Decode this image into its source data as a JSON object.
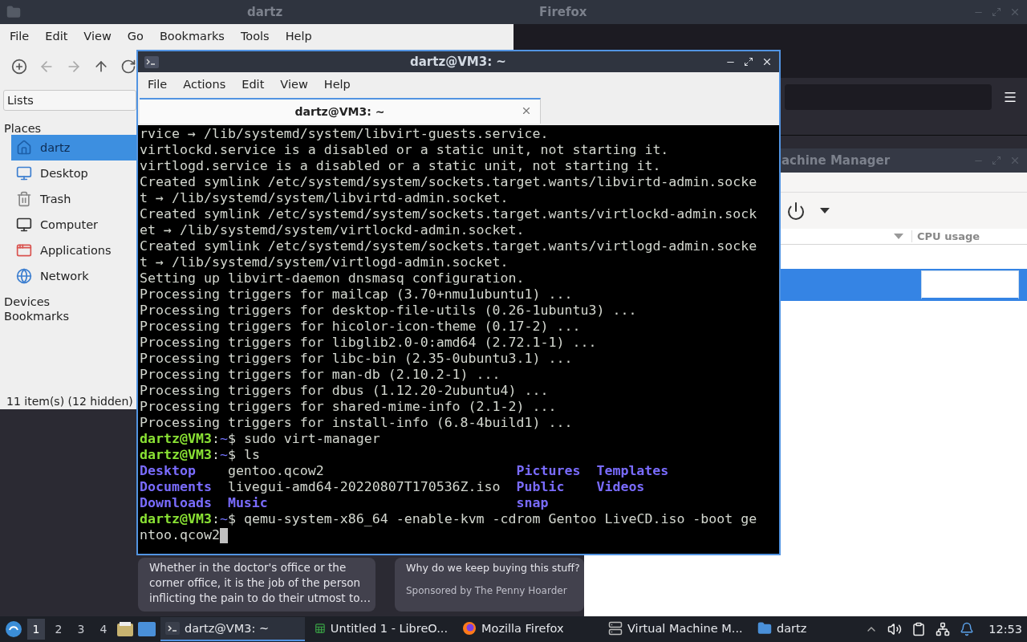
{
  "firefox": {
    "title": "Firefox",
    "cards": [
      {
        "lines": [
          "Whether in the doctor's office or the",
          "corner office, it is the job of the person",
          "inflicting the pain to do their utmost to…"
        ]
      },
      {
        "title": "Why do we keep buying this stuff?",
        "sponsor": "Sponsored by The Penny Hoarder"
      }
    ]
  },
  "file_manager": {
    "title": "dartz",
    "menu": [
      "File",
      "Edit",
      "View",
      "Go",
      "Bookmarks",
      "Tools",
      "Help"
    ],
    "toolbar": [
      {
        "kind": "new-window",
        "disabled": false
      },
      {
        "kind": "back",
        "disabled": true
      },
      {
        "kind": "forward",
        "disabled": true
      },
      {
        "kind": "up",
        "disabled": false
      },
      {
        "kind": "reload",
        "disabled": false
      }
    ],
    "side_view": "Lists",
    "places_label": "Places",
    "places": [
      {
        "label": "dartz",
        "kind": "home",
        "selected": true
      },
      {
        "label": "Desktop",
        "kind": "desktop",
        "selected": false
      },
      {
        "label": "Trash",
        "kind": "trash",
        "selected": false
      },
      {
        "label": "Computer",
        "kind": "computer",
        "selected": false
      },
      {
        "label": "Applications",
        "kind": "applications",
        "selected": false
      },
      {
        "label": "Network",
        "kind": "network",
        "selected": false
      }
    ],
    "other_sections": [
      "Devices",
      "Bookmarks"
    ],
    "status": "11 item(s) (12 hidden)"
  },
  "virt_manager": {
    "title": "achine Manager",
    "column": "CPU usage",
    "rows": [
      {
        "selected": true
      }
    ]
  },
  "terminal": {
    "title": "dartz@VM3: ~",
    "menu": [
      "File",
      "Actions",
      "Edit",
      "View",
      "Help"
    ],
    "tab": {
      "label": "dartz@VM3: ~",
      "selected": true
    },
    "cursor_visible": true,
    "lines": [
      [
        {
          "kind": "text",
          "text": "rvice → /lib/systemd/system/libvirt-guests.service."
        }
      ],
      [
        {
          "kind": "text",
          "text": "virtlockd.service is a disabled or a static unit, not starting it."
        }
      ],
      [
        {
          "kind": "text",
          "text": "virtlogd.service is a disabled or a static unit, not starting it."
        }
      ],
      [
        {
          "kind": "text",
          "text": "Created symlink /etc/systemd/system/sockets.target.wants/libvirtd-admin.socke"
        }
      ],
      [
        {
          "kind": "text",
          "text": "t → /lib/systemd/system/libvirtd-admin.socket."
        }
      ],
      [
        {
          "kind": "text",
          "text": "Created symlink /etc/systemd/system/sockets.target.wants/virtlockd-admin.sock"
        }
      ],
      [
        {
          "kind": "text",
          "text": "et → /lib/systemd/system/virtlockd-admin.socket."
        }
      ],
      [
        {
          "kind": "text",
          "text": "Created symlink /etc/systemd/system/sockets.target.wants/virtlogd-admin.socke"
        }
      ],
      [
        {
          "kind": "text",
          "text": "t → /lib/systemd/system/virtlogd-admin.socket."
        }
      ],
      [
        {
          "kind": "text",
          "text": "Setting up libvirt-daemon dnsmasq configuration."
        }
      ],
      [
        {
          "kind": "text",
          "text": "Processing triggers for mailcap (3.70+nmu1ubuntu1) ..."
        }
      ],
      [
        {
          "kind": "text",
          "text": "Processing triggers for desktop-file-utils (0.26-1ubuntu3) ..."
        }
      ],
      [
        {
          "kind": "text",
          "text": "Processing triggers for hicolor-icon-theme (0.17-2) ..."
        }
      ],
      [
        {
          "kind": "text",
          "text": "Processing triggers for libglib2.0-0:amd64 (2.72.1-1) ..."
        }
      ],
      [
        {
          "kind": "text",
          "text": "Processing triggers for libc-bin (2.35-0ubuntu3.1) ..."
        }
      ],
      [
        {
          "kind": "text",
          "text": "Processing triggers for man-db (2.10.2-1) ..."
        }
      ],
      [
        {
          "kind": "text",
          "text": "Processing triggers for dbus (1.12.20-2ubuntu4) ..."
        }
      ],
      [
        {
          "kind": "text",
          "text": "Processing triggers for shared-mime-info (2.1-2) ..."
        }
      ],
      [
        {
          "kind": "text",
          "text": "Processing triggers for install-info (6.8-4build1) ..."
        }
      ],
      [
        {
          "kind": "user",
          "text": "dartz@VM3"
        },
        {
          "kind": "text",
          "text": ":"
        },
        {
          "kind": "path",
          "text": "~"
        },
        {
          "kind": "text",
          "text": "$ sudo virt-manager"
        }
      ],
      [
        {
          "kind": "user",
          "text": "dartz@VM3"
        },
        {
          "kind": "text",
          "text": ":"
        },
        {
          "kind": "path",
          "text": "~"
        },
        {
          "kind": "text",
          "text": "$ ls"
        }
      ],
      {
        "kind": "ls",
        "cells": [
          {
            "kind": "dir",
            "text": "Desktop"
          },
          {
            "kind": "text",
            "text": "gentoo.qcow2"
          },
          {
            "kind": "dir",
            "text": "Pictures"
          },
          {
            "kind": "dir",
            "text": "Templates"
          }
        ]
      },
      {
        "kind": "ls",
        "cells": [
          {
            "kind": "dir",
            "text": "Documents"
          },
          {
            "kind": "text",
            "text": "livegui-amd64-20220807T170536Z.iso"
          },
          {
            "kind": "dir",
            "text": "Public"
          },
          {
            "kind": "dir",
            "text": "Videos"
          }
        ]
      },
      {
        "kind": "ls",
        "cells": [
          {
            "kind": "dir",
            "text": "Downloads"
          },
          {
            "kind": "dir",
            "text": "Music"
          },
          {
            "kind": "dir",
            "text": "snap"
          }
        ]
      },
      [
        {
          "kind": "user",
          "text": "dartz@VM3"
        },
        {
          "kind": "text",
          "text": ":"
        },
        {
          "kind": "path",
          "text": "~"
        },
        {
          "kind": "text",
          "text": "$ qemu-system-x86_64 -enable-kvm -cdrom Gentoo LiveCD.iso -boot ge"
        }
      ],
      [
        {
          "kind": "text",
          "text": "ntoo.qcow2"
        }
      ]
    ]
  },
  "taskbar": {
    "workspaces": [
      {
        "label": "1",
        "selected": true
      },
      {
        "label": "2",
        "selected": false
      },
      {
        "label": "3",
        "selected": false
      },
      {
        "label": "4",
        "selected": false
      }
    ],
    "tasks": [
      {
        "label": "dartz@VM3: ~",
        "kind": "terminal",
        "selected": true
      },
      {
        "label": "Untitled 1 - LibreO...",
        "kind": "spreadsheet",
        "selected": false
      },
      {
        "label": "Mozilla Firefox",
        "kind": "browser",
        "selected": false
      },
      {
        "label": "Virtual Machine M...",
        "kind": "vm",
        "selected": false
      },
      {
        "label": "dartz",
        "kind": "folder",
        "selected": false
      }
    ],
    "clock": "12:53"
  }
}
